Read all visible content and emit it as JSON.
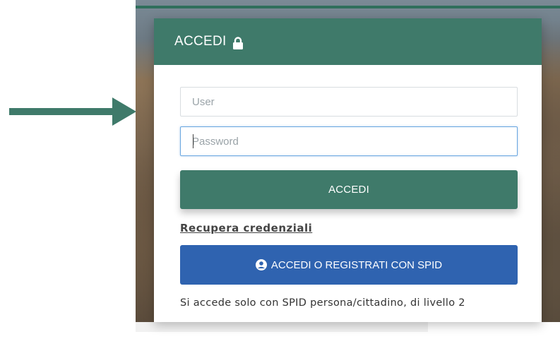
{
  "login": {
    "title": "ACCEDI",
    "user_placeholder": "User",
    "password_placeholder": "Password",
    "login_button": "ACCEDI",
    "recover_link": "Recupera credenziali",
    "spid_button": "ACCEDI O REGISTRATI CON SPID",
    "spid_note": "Si accede solo con SPID persona/cittadino, di livello 2"
  },
  "icons": {
    "header": "lock-icon",
    "spid": "user-circle-icon",
    "pointer": "arrow-right-icon"
  },
  "colors": {
    "primary_green": "#3f7a6a",
    "spid_blue": "#2f63b0",
    "focus_border": "#6aa7e0"
  }
}
